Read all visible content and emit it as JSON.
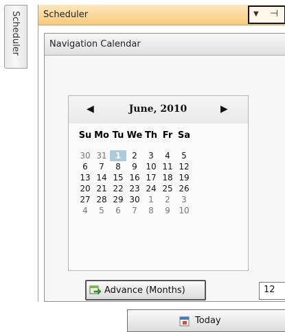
{
  "side_tab": {
    "label": "Scheduler"
  },
  "pane": {
    "title": "Scheduler",
    "controls": {
      "dropdown_icon": "chevron-down-icon",
      "pin_icon": "pin-icon"
    }
  },
  "group": {
    "title": "Navigation Calendar"
  },
  "calendar": {
    "title": "June, 2010",
    "prev_icon": "chevron-left-icon",
    "next_icon": "chevron-right-icon",
    "day_headers": [
      "Su",
      "Mo",
      "Tu",
      "We",
      "Th",
      "Fr",
      "Sa"
    ],
    "weeks": [
      [
        "30",
        "31",
        "1",
        "2",
        "3",
        "4",
        "5"
      ],
      [
        "6",
        "7",
        "8",
        "9",
        "10",
        "11",
        "12"
      ],
      [
        "13",
        "14",
        "15",
        "16",
        "17",
        "18",
        "19"
      ],
      [
        "20",
        "21",
        "22",
        "23",
        "24",
        "25",
        "26"
      ],
      [
        "27",
        "28",
        "29",
        "30",
        "1",
        "2",
        "3"
      ],
      [
        "4",
        "5",
        "6",
        "7",
        "8",
        "9",
        "10"
      ]
    ],
    "selected_day": "1"
  },
  "advance": {
    "label": "Advance (Months)",
    "value": "12",
    "icon": "calendar-arrow-icon"
  },
  "today": {
    "label": "Today",
    "icon": "today-icon"
  },
  "colors": {
    "header_orange": "#f7cb7d",
    "selected_day_bg": "#a9cbdc"
  }
}
